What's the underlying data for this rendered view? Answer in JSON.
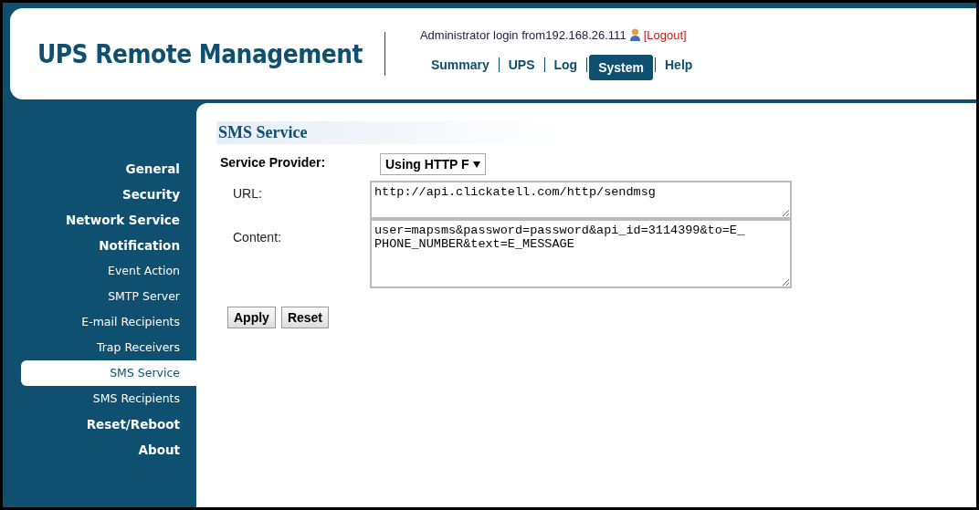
{
  "header": {
    "logo": "UPS Remote Management",
    "login_text": "Administrator login from192.168.26.111",
    "logout": "[Logout]",
    "nav": [
      {
        "label": "Summary",
        "selected": false
      },
      {
        "label": "UPS",
        "selected": false
      },
      {
        "label": "Log",
        "selected": false
      },
      {
        "label": "System",
        "selected": true
      },
      {
        "label": "Help",
        "selected": false
      }
    ]
  },
  "sidebar": {
    "items": [
      {
        "label": "General",
        "kind": "section",
        "selected": false
      },
      {
        "label": "Security",
        "kind": "section",
        "selected": false
      },
      {
        "label": "Network Service",
        "kind": "section",
        "selected": false
      },
      {
        "label": "Notification",
        "kind": "section",
        "selected": false
      },
      {
        "label": "Event Action",
        "kind": "sub",
        "selected": false
      },
      {
        "label": "SMTP Server",
        "kind": "sub",
        "selected": false
      },
      {
        "label": "E-mail Recipients",
        "kind": "sub",
        "selected": false
      },
      {
        "label": "Trap Receivers",
        "kind": "sub",
        "selected": false
      },
      {
        "label": "SMS Service",
        "kind": "sub",
        "selected": true
      },
      {
        "label": "SMS Recipients",
        "kind": "sub",
        "selected": false
      },
      {
        "label": "Reset/Reboot",
        "kind": "section",
        "selected": false
      },
      {
        "label": "About",
        "kind": "section",
        "selected": false
      }
    ]
  },
  "content": {
    "title": "SMS Service",
    "provider_label": "Service Provider:",
    "provider_value": "Using HTTP F",
    "url_label": "URL:",
    "url_value": "http://api.clickatell.com/http/sendmsg",
    "content_label": "Content:",
    "content_value": "user=mapsms&password=password&api_id=3114399&to=E_PHONE_NUMBER&text=E_MESSAGE",
    "buttons": [
      "Apply",
      "Reset"
    ]
  }
}
